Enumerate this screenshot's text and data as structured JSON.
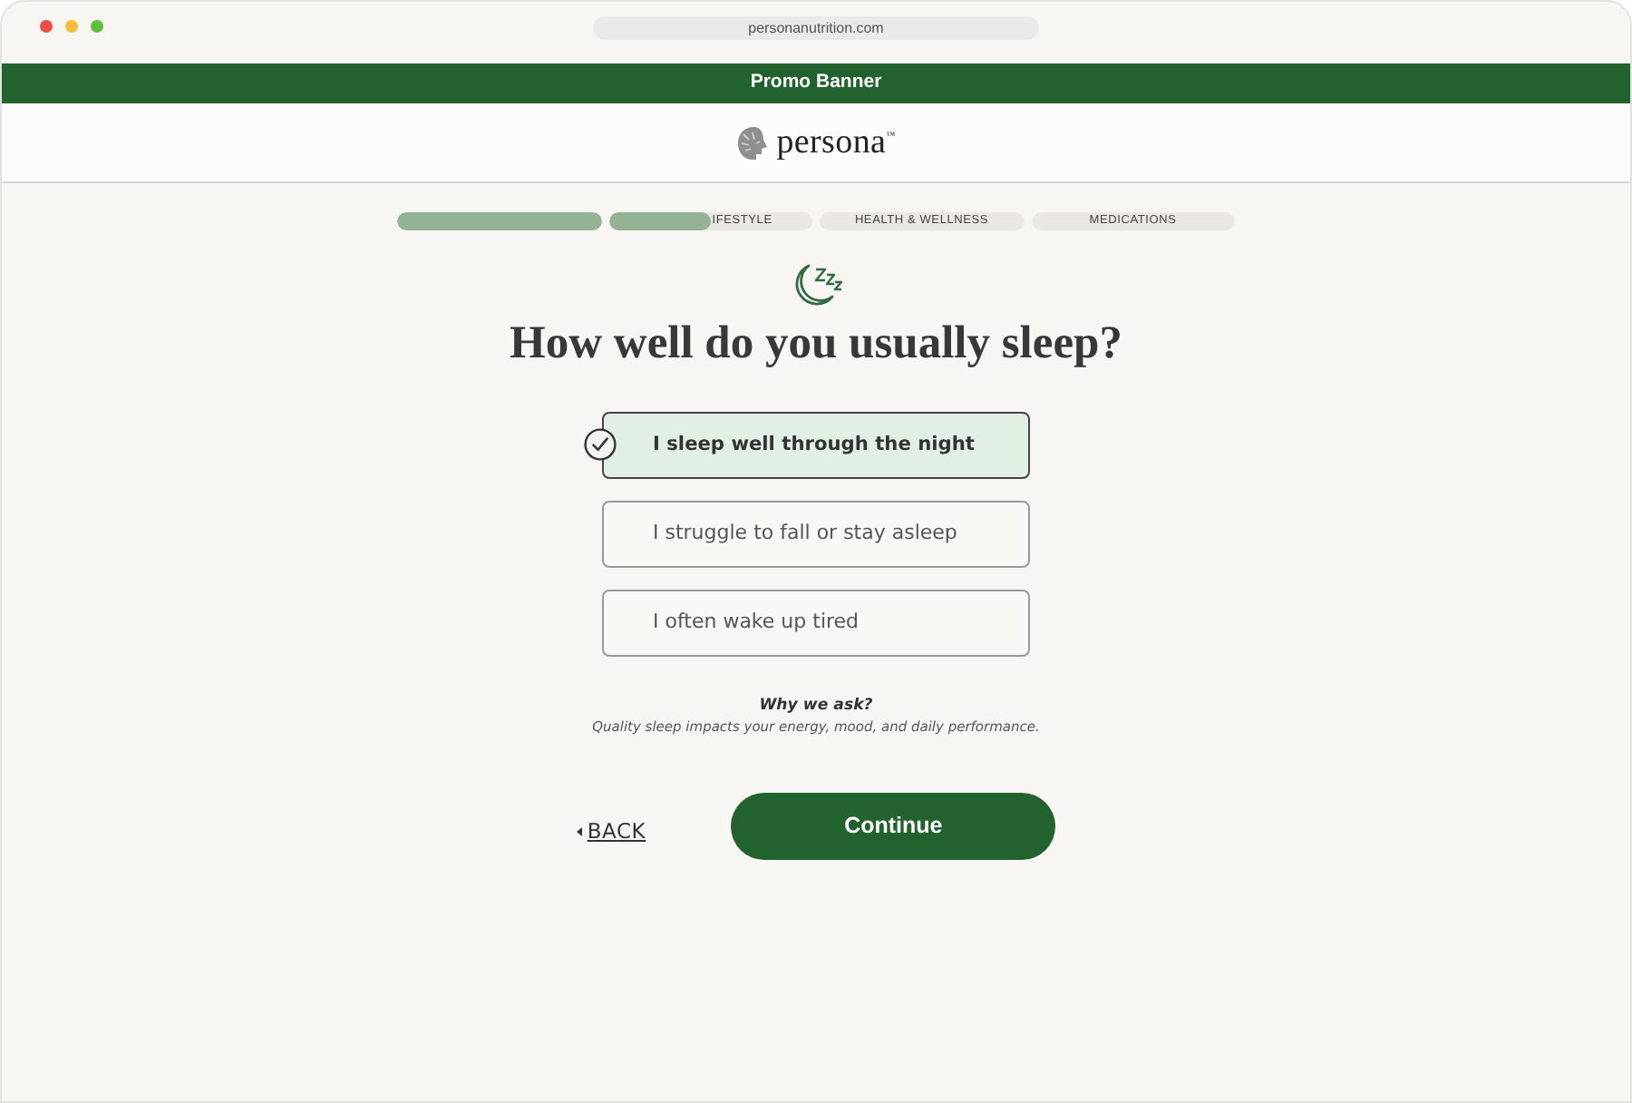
{
  "browser": {
    "url": "personanutrition.com"
  },
  "promo_banner": {
    "text": "Promo Banner"
  },
  "header": {
    "logo": "persona$^{™}$"
  },
  "progress": [
    {
      "level": 1
    },
    {
      "label": "IFESTYLE",
      "level": 0.5
    },
    {
      "label": "HEALTH & WELLNESS"
    },
    {
      "label": "MEDICATIONS"
    }
  ],
  "question": {
    "title": "How well do you usually sleep?"
  },
  "options": [
    {
      "label": "I sleep well through the night",
      "selected": true
    },
    {
      "label": "I struggle to fall or stay asleep",
      "selected": false
    },
    {
      "label": "I often wake up tired",
      "selected": false
    }
  ],
  "why": {
    "title": "Why we ask?",
    "text": "Quality sleep impacts your energy, mood, and daily performance."
  },
  "actions": {
    "back": "BACK",
    "continue": "Continue"
  }
}
